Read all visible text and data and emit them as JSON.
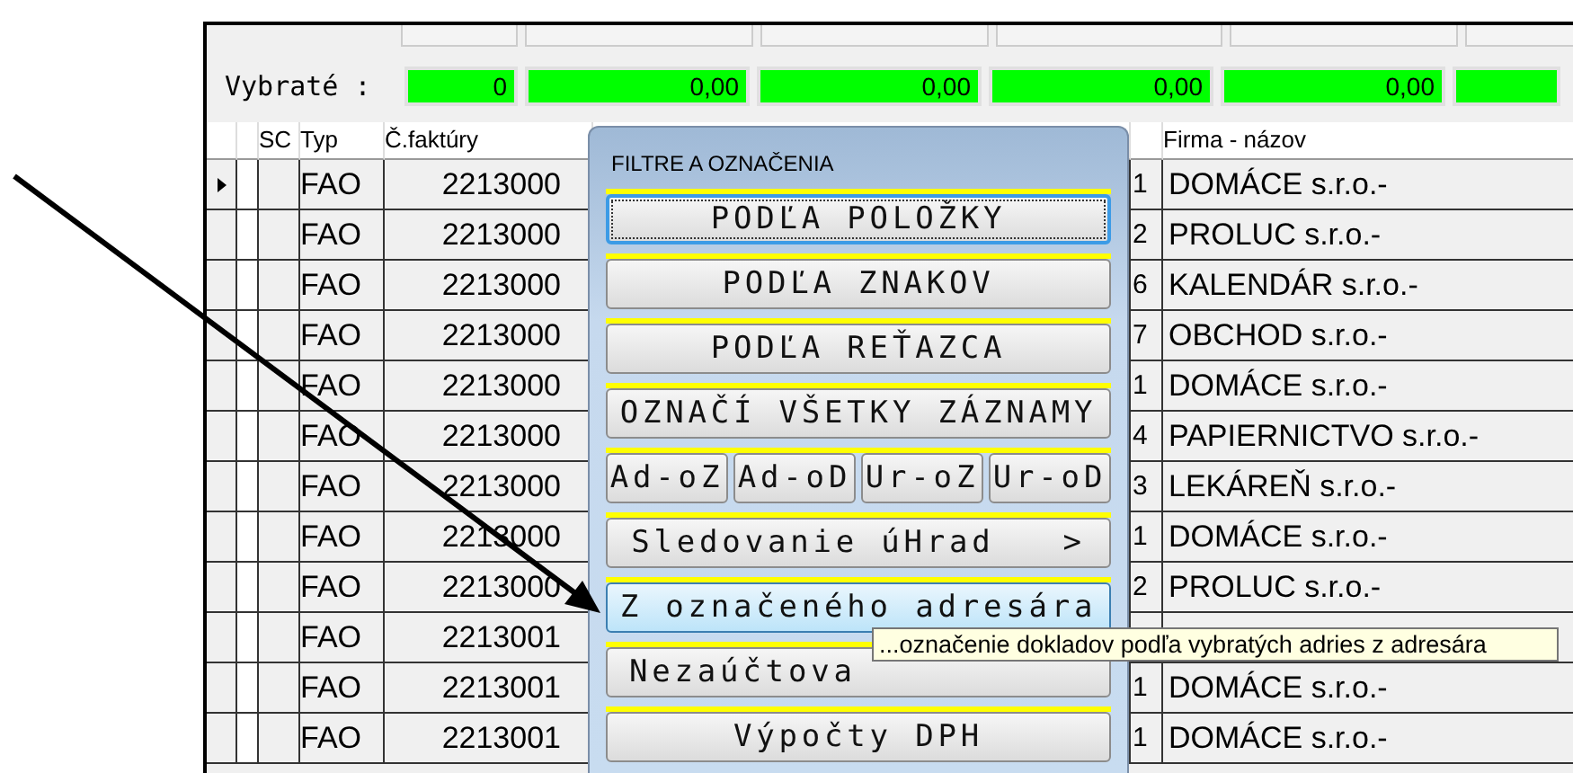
{
  "totals": {
    "label": "Vybraté :",
    "values": [
      "0",
      "0,00",
      "0,00",
      "0,00",
      "0,00"
    ]
  },
  "grid": {
    "columns": [
      "SC",
      "Typ",
      "Č.faktúry",
      "Firma - názov"
    ],
    "rows": [
      {
        "selected": true,
        "type": "FAO",
        "invoice": "2213000",
        "code": "1",
        "company": "DOMÁCE s.r.o.-"
      },
      {
        "selected": false,
        "type": "FAO",
        "invoice": "2213000",
        "code": "2",
        "company": "PROLUC s.r.o.-"
      },
      {
        "selected": false,
        "type": "FAO",
        "invoice": "2213000",
        "code": "6",
        "company": "KALENDÁR s.r.o.-"
      },
      {
        "selected": false,
        "type": "FAO",
        "invoice": "2213000",
        "code": "7",
        "company": "OBCHOD s.r.o.-"
      },
      {
        "selected": false,
        "type": "FAO",
        "invoice": "2213000",
        "code": "1",
        "company": "DOMÁCE s.r.o.-"
      },
      {
        "selected": false,
        "type": "FAO",
        "invoice": "2213000",
        "code": "4",
        "company": "PAPIERNICTVO s.r.o.-"
      },
      {
        "selected": false,
        "type": "FAO",
        "invoice": "2213000",
        "code": "3",
        "company": "LEKÁREŇ s.r.o.-"
      },
      {
        "selected": false,
        "type": "FAO",
        "invoice": "2213000",
        "code": "1",
        "company": "DOMÁCE s.r.o.-"
      },
      {
        "selected": false,
        "type": "FAO",
        "invoice": "2213000",
        "code": "2",
        "company": "PROLUC s.r.o.-"
      },
      {
        "selected": false,
        "type": "FAO",
        "invoice": "2213001"
      },
      {
        "selected": false,
        "type": "FAO",
        "invoice": "2213001",
        "code": "1",
        "company": "DOMÁCE s.r.o.-"
      },
      {
        "selected": false,
        "type": "FAO",
        "invoice": "2213001",
        "code": "1",
        "company": "DOMÁCE s.r.o.-"
      }
    ]
  },
  "popup": {
    "title": "FILTRE A OZNAČENIA",
    "items": [
      {
        "kind": "button",
        "label": "PODĽA POLOŽKY",
        "focused": true,
        "hovered": false
      },
      {
        "kind": "button",
        "label": "PODĽA ZNAKOV",
        "focused": false,
        "hovered": false
      },
      {
        "kind": "button",
        "label": "PODĽA REŤAZCA",
        "focused": false,
        "hovered": false
      },
      {
        "kind": "button",
        "label": "OZNAČÍ VŠETKY ZÁZNAMY",
        "focused": false,
        "hovered": false
      },
      {
        "kind": "group",
        "buttons": [
          "Ad-oZ",
          "Ad-oD",
          "Ur-oZ",
          "Ur-oD"
        ]
      },
      {
        "kind": "button",
        "label": "Sledovanie úHrad   >",
        "focused": false,
        "hovered": false
      },
      {
        "kind": "button",
        "label": "Z označeného adresára",
        "focused": false,
        "hovered": true
      },
      {
        "kind": "partial-button",
        "label": "Nezaúčtova",
        "focused": false,
        "hovered": false
      },
      {
        "kind": "button",
        "label": "Výpočty DPH",
        "focused": false,
        "hovered": false
      }
    ]
  },
  "tooltip": {
    "text": "...označenie dokladov podľa vybratých adries z adresára"
  }
}
